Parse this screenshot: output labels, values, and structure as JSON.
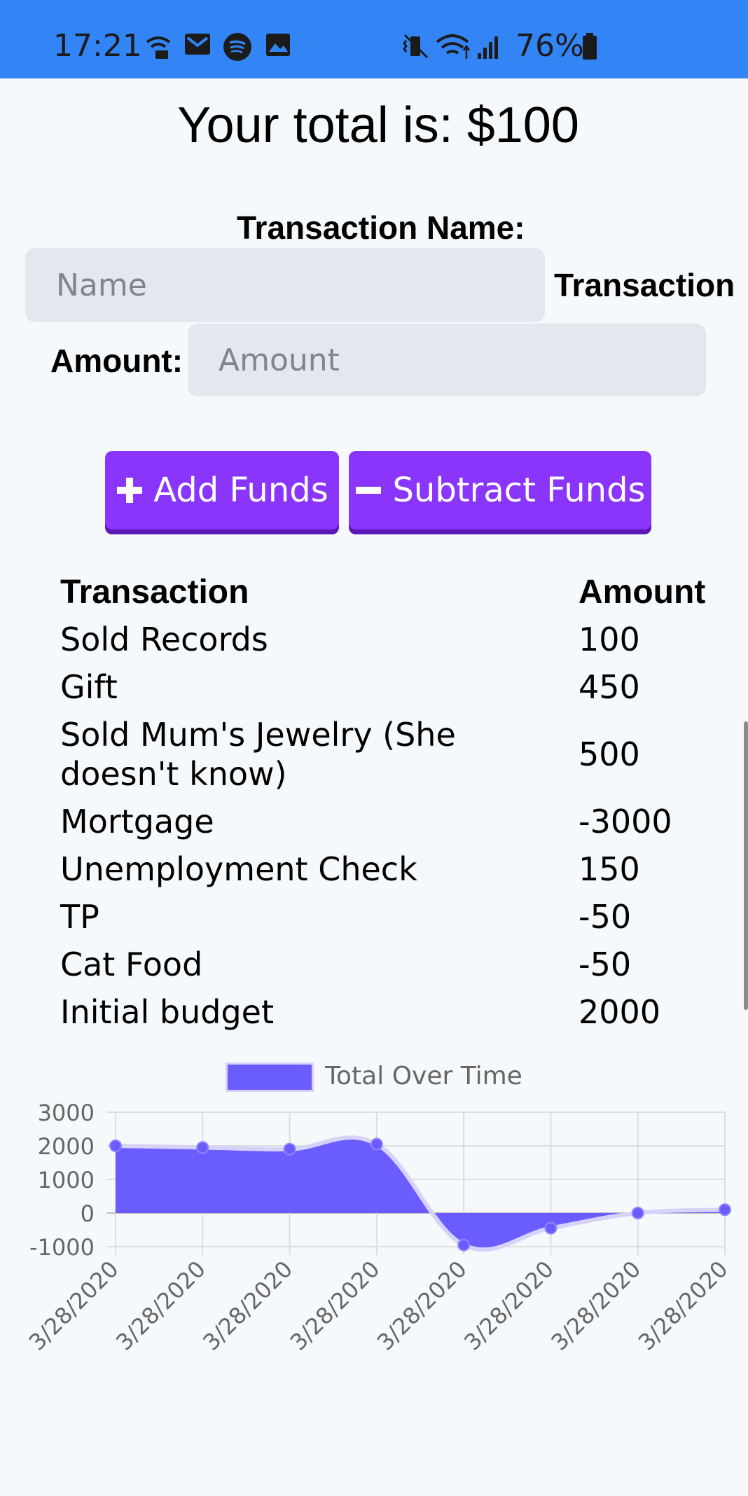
{
  "status_bar": {
    "time": "17:21",
    "battery": "76%",
    "left_icons": [
      "wifi-call-icon",
      "gmail-icon",
      "spotify-icon",
      "gallery-icon"
    ],
    "right_icons": [
      "vibrate-icon",
      "wifi-icon",
      "signal-icon",
      "battery-icon"
    ]
  },
  "total_text": "Your total is: $100",
  "form": {
    "name_label": "Transaction Name:",
    "name_placeholder": "Name",
    "amount_label": "Transaction Amount:",
    "amount_label_part1": "Transaction",
    "amount_label_part2": "Amount:",
    "amount_placeholder": "Amount",
    "add_label": "Add Funds",
    "subtract_label": "Subtract Funds"
  },
  "table": {
    "headers": [
      "Transaction",
      "Amount"
    ],
    "rows": [
      {
        "name": "Sold Records",
        "amount": "100"
      },
      {
        "name": "Gift",
        "amount": "450"
      },
      {
        "name": "Sold Mum's Jewelry (She doesn't know)",
        "amount": "500"
      },
      {
        "name": "Mortgage",
        "amount": "-3000"
      },
      {
        "name": "Unemployment Check",
        "amount": "150"
      },
      {
        "name": "TP",
        "amount": "-50"
      },
      {
        "name": "Cat Food",
        "amount": "-50"
      },
      {
        "name": "Initial budget",
        "amount": "2000"
      }
    ]
  },
  "colors": {
    "status_bar": "#3385f6",
    "button": "#8a35fb",
    "series_fill": "#6a5cff",
    "input_bg": "#e3e8ee"
  },
  "chart_data": {
    "type": "area",
    "legend": "Total Over Time",
    "legend_position": "top",
    "categories": [
      "3/28/2020",
      "3/28/2020",
      "3/28/2020",
      "3/28/2020",
      "3/28/2020",
      "3/28/2020",
      "3/28/2020",
      "3/28/2020"
    ],
    "series": [
      {
        "name": "Total Over Time",
        "values": [
          2000,
          1950,
          1900,
          2050,
          -950,
          -450,
          0,
          100
        ]
      }
    ],
    "yticks": [
      "3000",
      "2000",
      "1000",
      "0",
      "-1000"
    ],
    "ylim": [
      -1000,
      3000
    ],
    "grid": true
  }
}
